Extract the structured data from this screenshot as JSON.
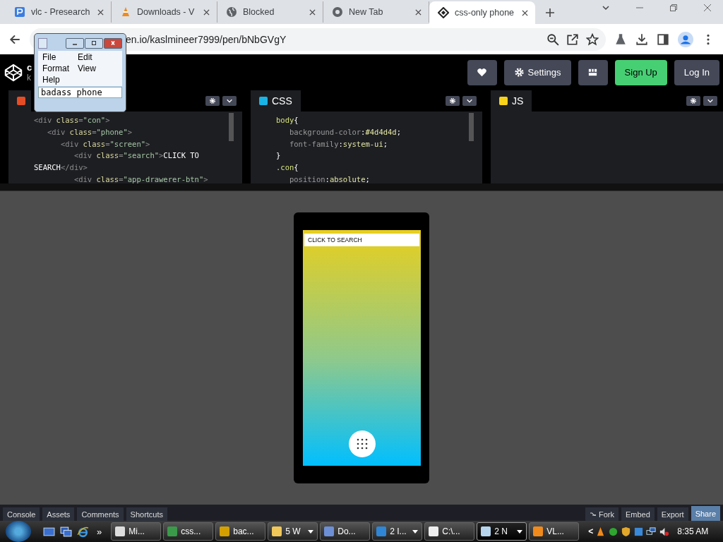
{
  "browser": {
    "tabs": [
      {
        "label": "vlc - Presearch",
        "selected": false
      },
      {
        "label": "Downloads - V",
        "selected": false
      },
      {
        "label": "Blocked",
        "selected": false
      },
      {
        "label": "New Tab",
        "selected": false
      },
      {
        "label": "css-only phone",
        "selected": true
      }
    ],
    "url": "en.io/kaslmineer7999/pen/bNbGVgY"
  },
  "codepen": {
    "title": "c",
    "author": "k",
    "buttons": [
      {
        "kind": "heart"
      },
      {
        "kind": "settings",
        "label": "Settings"
      },
      {
        "kind": "layout"
      },
      {
        "kind": "signup",
        "label": "Sign Up"
      },
      {
        "kind": "login",
        "label": "Log In"
      }
    ],
    "editors": [
      {
        "kind": "html",
        "color": "#e44d26",
        "lines": [
          [
            {
              "kind": "tag",
              "text": "<div "
            },
            {
              "kind": "attr",
              "text": "class"
            },
            {
              "kind": "tag",
              "text": "="
            },
            {
              "kind": "str",
              "text": "\"con\""
            },
            {
              "kind": "tag",
              "text": ">"
            }
          ],
          [
            {
              "kind": "tag",
              "text": "   <div "
            },
            {
              "kind": "attr",
              "text": "class"
            },
            {
              "kind": "tag",
              "text": "="
            },
            {
              "kind": "str",
              "text": "\"phone\""
            },
            {
              "kind": "tag",
              "text": ">"
            }
          ],
          [
            {
              "kind": "tag",
              "text": "      <div "
            },
            {
              "kind": "attr",
              "text": "class"
            },
            {
              "kind": "tag",
              "text": "="
            },
            {
              "kind": "str",
              "text": "\"screen\""
            },
            {
              "kind": "tag",
              "text": ">"
            }
          ],
          [
            {
              "kind": "tag",
              "text": "         <div "
            },
            {
              "kind": "attr",
              "text": "class"
            },
            {
              "kind": "tag",
              "text": "="
            },
            {
              "kind": "str",
              "text": "\"search\""
            },
            {
              "kind": "tag",
              "text": ">"
            },
            {
              "kind": "plain",
              "text": "CLICK TO"
            }
          ],
          [
            {
              "kind": "plain",
              "text": "SEARCH"
            },
            {
              "kind": "tag",
              "text": "</div>"
            }
          ],
          [
            {
              "kind": "tag",
              "text": "         <div "
            },
            {
              "kind": "attr",
              "text": "class"
            },
            {
              "kind": "tag",
              "text": "="
            },
            {
              "kind": "str",
              "text": "\"app-drawerer-btn\""
            },
            {
              "kind": "tag",
              "text": ">"
            }
          ]
        ]
      },
      {
        "kind": "css",
        "label": "CSS",
        "color": "#1ab3e6",
        "lines": [
          [
            {
              "kind": "sel",
              "text": "body"
            },
            {
              "kind": "plain",
              "text": "{"
            }
          ],
          [
            {
              "kind": "prop",
              "text": "   background-color"
            },
            {
              "kind": "plain",
              "text": ":"
            },
            {
              "kind": "val",
              "text": "#4d4d4d"
            },
            {
              "kind": "plain",
              "text": ";"
            }
          ],
          [
            {
              "kind": "prop",
              "text": "   font-family"
            },
            {
              "kind": "plain",
              "text": ":"
            },
            {
              "kind": "val",
              "text": "system-ui"
            },
            {
              "kind": "plain",
              "text": ";"
            }
          ],
          [
            {
              "kind": "plain",
              "text": "}"
            }
          ],
          [
            {
              "kind": "sel",
              "text": ".con"
            },
            {
              "kind": "plain",
              "text": "{"
            }
          ],
          [
            {
              "kind": "prop",
              "text": "   position"
            },
            {
              "kind": "plain",
              "text": ":"
            },
            {
              "kind": "val",
              "text": "absolute"
            },
            {
              "kind": "plain",
              "text": ";"
            }
          ]
        ]
      },
      {
        "kind": "js",
        "label": "JS",
        "color": "#f7d21a"
      }
    ],
    "preview": {
      "search": "CLICK TO SEARCH"
    },
    "footer_left": [
      "Console",
      "Assets",
      "Comments",
      "Shortcuts"
    ],
    "footer_right": [
      {
        "kind": "fork",
        "label": "Fork"
      },
      {
        "kind": "plain",
        "label": "Embed"
      },
      {
        "kind": "plain",
        "label": "Export"
      },
      {
        "kind": "share",
        "label": "Share"
      }
    ]
  },
  "notepad": {
    "menu": [
      "File",
      "Edit",
      "Format",
      "View",
      "Help"
    ],
    "text": "badass phone"
  },
  "taskbar": {
    "tasks": [
      {
        "label": "Mi...",
        "group": false,
        "selected": false
      },
      {
        "label": "css...",
        "group": false,
        "selected": false
      },
      {
        "label": "bac...",
        "group": false,
        "selected": false
      },
      {
        "label": "5 W",
        "group": true,
        "selected": false
      },
      {
        "label": "Do...",
        "group": false,
        "selected": false
      },
      {
        "label": "2 I...",
        "group": true,
        "selected": false
      },
      {
        "label": "C:\\...",
        "group": false,
        "selected": false
      },
      {
        "label": "2 N",
        "group": true,
        "selected": true
      },
      {
        "label": "VL...",
        "group": false,
        "selected": false
      }
    ],
    "chevron": "»",
    "tray_arrow": "<",
    "time": "8:35 AM"
  }
}
